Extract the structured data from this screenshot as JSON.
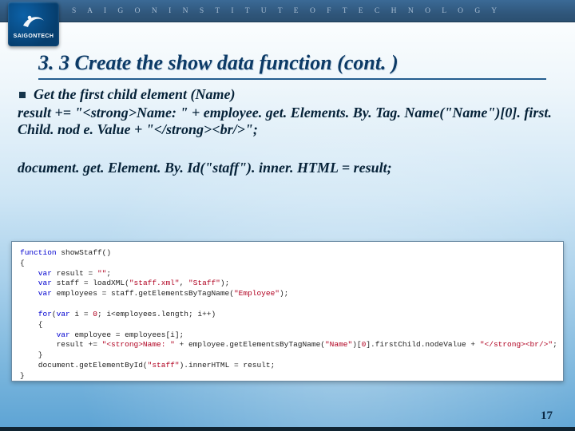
{
  "header": {
    "institute": "S A I G O N   I N S T I T U T E   O F   T E C H N O L O G Y",
    "brand": "SAIGONTECH"
  },
  "title": "3. 3 Create the show data function (cont. )",
  "content": {
    "bullet1": "Get the first child element (Name)",
    "line1": "result += \"<strong>Name: \" + employee. get. Elements. By. Tag. Name(\"Name\")[0]. first. Child. nod e. Value + \"</strong><br/>\";",
    "line2": "document. get. Element. By. Id(\"staff\"). inner. HTML = result;"
  },
  "code_box": {
    "l1_a": "function",
    "l1_b": " showStaff()",
    "l2": "{",
    "l3_a": "    var",
    "l3_b": " result = ",
    "l3_c": "\"\"",
    "l3_d": ";",
    "l4_a": "    var",
    "l4_b": " staff = loadXML(",
    "l4_c": "\"staff.xml\"",
    "l4_d": ", ",
    "l4_e": "\"Staff\"",
    "l4_f": ");",
    "l5_a": "    var",
    "l5_b": " employees = staff.getElementsByTagName(",
    "l5_c": "\"Employee\"",
    "l5_d": ");",
    "l6_a": "    for",
    "l6_b": "(",
    "l6_c": "var",
    "l6_d": " i = ",
    "l6_e": "0",
    "l6_f": "; i<employees.length; i++)",
    "l7": "    {",
    "l8_a": "        var",
    "l8_b": " employee = employees[i];",
    "l9_a": "        result += ",
    "l9_b": "\"<strong>Name: \"",
    "l9_c": " + employee.getElementsByTagName(",
    "l9_d": "\"Name\"",
    "l9_e": ")[",
    "l9_f": "0",
    "l9_g": "].firstChild.nodeValue + ",
    "l9_h": "\"</strong><br/>\"",
    "l9_i": ";",
    "l10": "    }",
    "l11_a": "    document.getElementById(",
    "l11_b": "\"staff\"",
    "l11_c": ").innerHTML = result;",
    "l12": "}"
  },
  "page_number": "17"
}
